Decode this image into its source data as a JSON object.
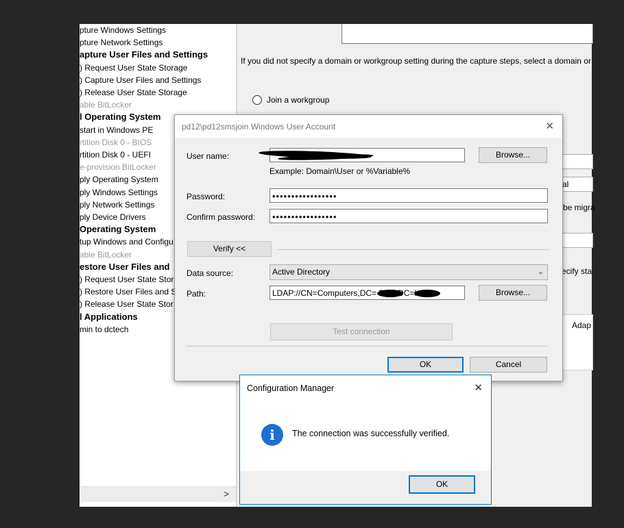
{
  "tree": {
    "items": [
      {
        "label": "pture Windows Settings",
        "style": ""
      },
      {
        "label": "pture Network Settings",
        "style": ""
      },
      {
        "label": "apture User Files and Settings",
        "style": "b"
      },
      {
        "label": ") Request User State Storage",
        "style": ""
      },
      {
        "label": ") Capture User Files and Settings",
        "style": ""
      },
      {
        "label": ") Release User State Storage",
        "style": ""
      },
      {
        "label": "able BitLocker",
        "style": "d"
      },
      {
        "label": "l Operating System",
        "style": "b"
      },
      {
        "label": "start in Windows PE",
        "style": ""
      },
      {
        "label": "rtition Disk 0 - BIOS",
        "style": "d"
      },
      {
        "label": "rtition Disk 0 - UEFI",
        "style": ""
      },
      {
        "label": "e-provision BitLocker",
        "style": "d"
      },
      {
        "label": "ply Operating System",
        "style": ""
      },
      {
        "label": "ply Windows Settings",
        "style": ""
      },
      {
        "label": "ply Network Settings",
        "style": ""
      },
      {
        "label": "ply Device Drivers",
        "style": ""
      },
      {
        "label": "Operating System",
        "style": "b"
      },
      {
        "label": "tup Windows and Configu",
        "style": ""
      },
      {
        "label": "able BitLocker",
        "style": "d"
      },
      {
        "label": "estore User Files and",
        "style": "b"
      },
      {
        "label": ") Request User State Stor",
        "style": ""
      },
      {
        "label": ") Restore User Files and S",
        "style": ""
      },
      {
        "label": ") Release User State Stor",
        "style": ""
      },
      {
        "label": "l Applications",
        "style": "b"
      },
      {
        "label": "min to dctech",
        "style": ""
      }
    ],
    "scroll_arrow": ">"
  },
  "right_pane": {
    "info_text": "If you did not specify a domain or workgroup setting during the capture steps, select a domain or",
    "join_workgroup_label": "Join a workgroup",
    "partial_1": "al",
    "partial_2": "be migra",
    "partial_3": "ecify sta",
    "partial_4": "Adap"
  },
  "account_dialog": {
    "title": "pd12\\pd12smsjoin Windows User Account",
    "close_glyph": "✕",
    "username_label": "User name:",
    "username_value": "",
    "example_text": "Example: Domain\\User or %Variable%",
    "password_label": "Password:",
    "password_value": "•••••••••••••••••",
    "confirm_label": "Confirm password:",
    "confirm_value": "•••••••••••••••••",
    "browse_label": "Browse...",
    "verify_label": "Verify <<",
    "datasource_label": "Data source:",
    "datasource_value": "Active Directory",
    "path_label": "Path:",
    "path_value": "LDAP://CN=Computers,DC=        DC=        DC=lo",
    "path_browse_label": "Browse...",
    "test_connection_label": "Test connection",
    "ok_label": "OK",
    "cancel_label": "Cancel"
  },
  "message_box": {
    "title": "Configuration Manager",
    "close_glyph": "✕",
    "icon_glyph": "i",
    "message": "The connection was successfully verified.",
    "ok_label": "OK"
  }
}
